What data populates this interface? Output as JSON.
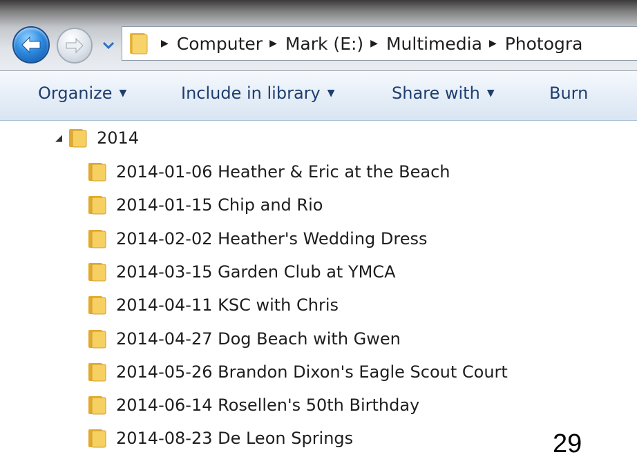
{
  "address_bar": {
    "breadcrumbs": [
      "Computer",
      "Mark (E:)",
      "Multimedia",
      "Photogra"
    ]
  },
  "toolbar": {
    "organize": "Organize",
    "include_in_library": "Include in library",
    "share_with": "Share with",
    "burn": "Burn"
  },
  "tree": {
    "parent": "2014",
    "folders": [
      "2014-01-06 Heather & Eric at the Beach",
      "2014-01-15 Chip and Rio",
      "2014-02-02 Heather's Wedding Dress",
      "2014-03-15 Garden Club at YMCA",
      "2014-04-11 KSC with Chris",
      "2014-04-27 Dog Beach with Gwen",
      "2014-05-26 Brandon Dixon's Eagle Scout Court",
      "2014-06-14 Rosellen's 50th Birthday",
      "2014-08-23 De Leon Springs"
    ]
  },
  "page_number": "29",
  "icons": {
    "back": "back-arrow-icon",
    "forward": "forward-arrow-icon",
    "recent": "chevron-down-icon",
    "folder": "folder-icon",
    "expander": "expanded-triangle-icon"
  },
  "colors": {
    "toolbar_text": "#1e3e6e",
    "folder": "#f3c64a",
    "back_button": "#2e8be0"
  }
}
